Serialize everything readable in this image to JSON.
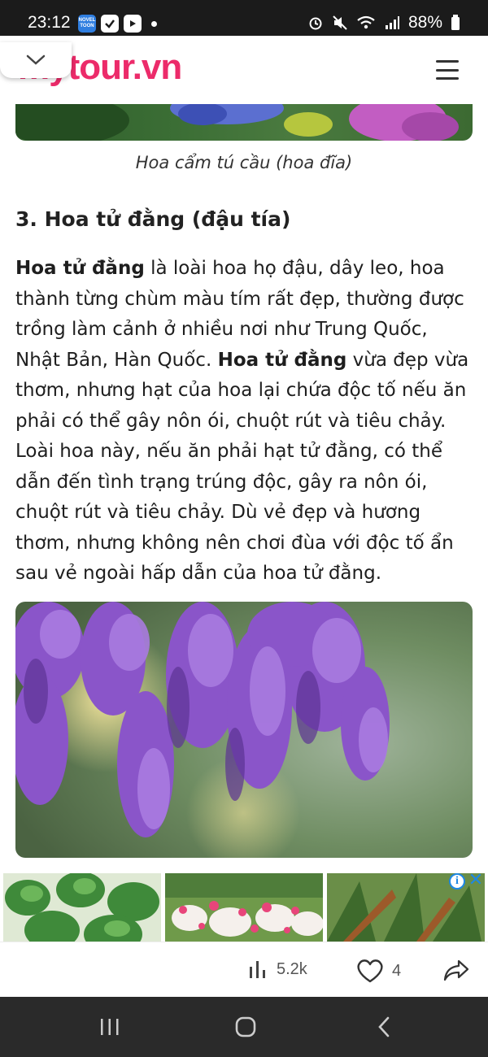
{
  "status_bar": {
    "time": "23:12",
    "battery": "88%",
    "app_icons": [
      "novel-toon-icon",
      "check-icon",
      "media-icon"
    ]
  },
  "header": {
    "logo": "mytour.vn"
  },
  "article": {
    "caption": "Hoa cẩm tú cầu (hoa đĩa)",
    "section_heading": "3. Hoa tử đằng (đậu tía)",
    "paragraph": {
      "bold_term_1": "Hoa tử đằng",
      "text_1": " là loài hoa họ đậu, dây leo, hoa thành từng chùm màu tím rất đẹp, thường được trồng làm cảnh ở nhiều nơi như Trung Quốc, Nhật Bản, Hàn Quốc. ",
      "bold_term_2": "Hoa tử đằng",
      "text_2": " vừa đẹp vừa thơm, nhưng hạt của hoa lại chứa độc tố nếu ăn phải có thể gây nôn ói, chuột rút và tiêu chảy. Loài hoa này, nếu ăn phải hạt tử đằng, có thể dẫn đến tình trạng trúng độc, gây ra nôn ói, chuột rút và tiêu chảy. Dù vẻ đẹp và hương thơm, nhưng không nên chơi đùa với độc tố ẩn sau vẻ ngoài hấp dẫn của hoa tử đằng."
    }
  },
  "ad": {
    "info_label": "i",
    "close_label": "✕"
  },
  "actions": {
    "views": "5.2k",
    "likes": "4"
  },
  "colors": {
    "brand": "#ec2b6a",
    "ad_accent": "#1e88e5"
  }
}
